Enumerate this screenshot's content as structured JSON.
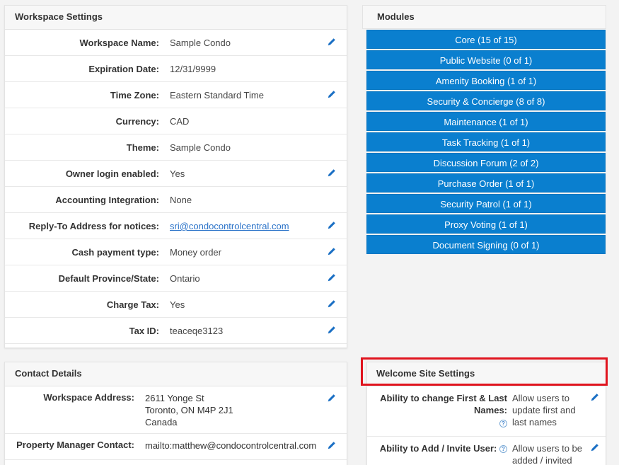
{
  "workspace": {
    "title": "Workspace Settings",
    "rows": [
      {
        "label": "Workspace Name:",
        "value": "Sample Condo",
        "editable": true
      },
      {
        "label": "Expiration Date:",
        "value": "12/31/9999",
        "editable": false
      },
      {
        "label": "Time Zone:",
        "value": "Eastern Standard Time",
        "editable": true
      },
      {
        "label": "Currency:",
        "value": "CAD",
        "editable": false
      },
      {
        "label": "Theme:",
        "value": "Sample Condo",
        "editable": false
      },
      {
        "label": "Owner login enabled:",
        "value": "Yes",
        "editable": true
      },
      {
        "label": "Accounting Integration:",
        "value": "None",
        "editable": false
      },
      {
        "label": "Reply-To Address for notices:",
        "value": "sri@condocontrolcentral.com",
        "editable": true
      },
      {
        "label": "Cash payment type:",
        "value": "Money order",
        "editable": true
      },
      {
        "label": "Default Province/State:",
        "value": "Ontario",
        "editable": true
      },
      {
        "label": "Charge Tax:",
        "value": "Yes",
        "editable": true
      },
      {
        "label": "Tax ID:",
        "value": "teaceqe3123",
        "editable": true
      }
    ]
  },
  "modules": {
    "title": "Modules",
    "items": [
      "Core (15 of 15)",
      "Public Website (0 of 1)",
      "Amenity Booking (1 of 1)",
      "Security & Concierge (8 of 8)",
      "Maintenance (1 of 1)",
      "Task Tracking (1 of 1)",
      "Discussion Forum (2 of 2)",
      "Purchase Order (1 of 1)",
      "Security Patrol (1 of 1)",
      "Proxy Voting (1 of 1)",
      "Document Signing (0 of 1)"
    ]
  },
  "contact": {
    "title": "Contact Details",
    "address_label": "Workspace Address:",
    "address_line1": "2611 Yonge St",
    "address_line2": "Toronto, ON M4P 2J1",
    "address_line3": "Canada",
    "pm_label": "Property Manager Contact:",
    "pm_value": "mailto:matthew@condocontrolcentral.com"
  },
  "welcome": {
    "title": "Welcome Site Settings",
    "row1_label_line1": "Ability to change First & Last",
    "row1_label_line2": "Names:",
    "row1_value": "Allow users to update first and last names",
    "row2_label": "Ability to Add / Invite User:",
    "row2_value": "Allow users to be added / invited"
  },
  "icons": {
    "edit": "pencil-icon",
    "help": "question-icon"
  },
  "colors": {
    "module_button": "#0a7fcf",
    "edit_icon": "#1a6fc4",
    "link": "#2a72c8",
    "highlight": "#e0141e"
  }
}
